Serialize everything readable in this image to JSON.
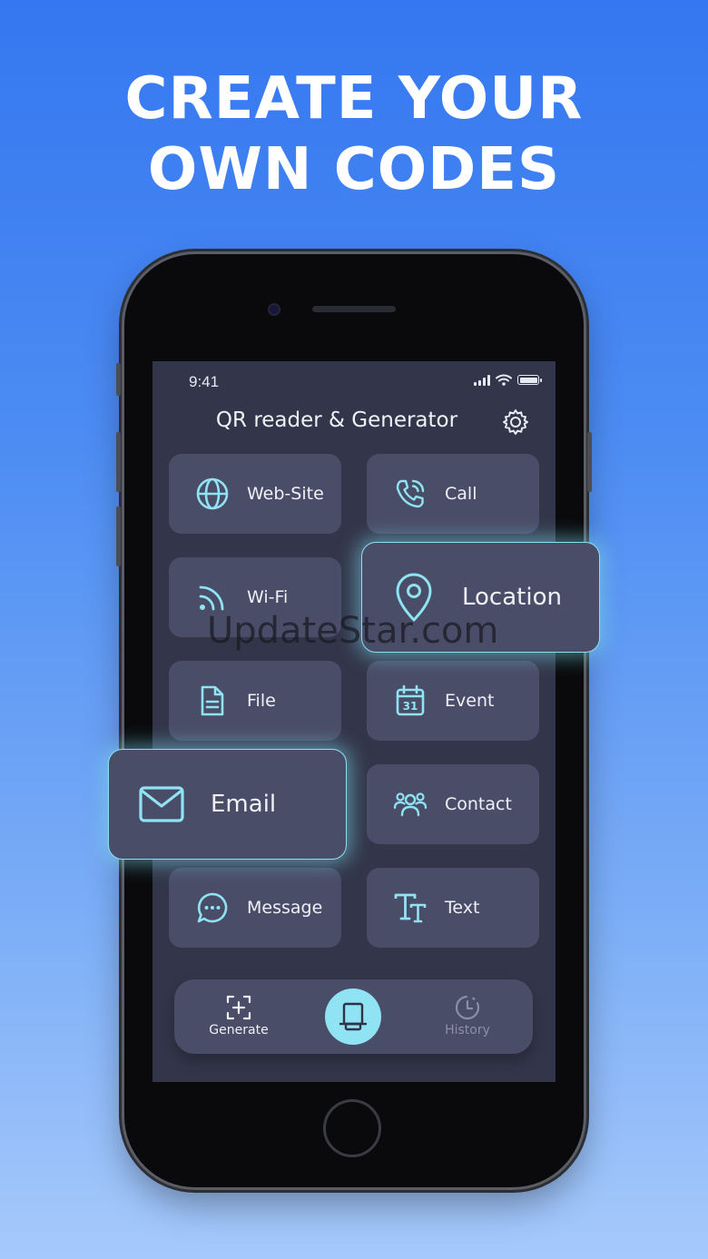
{
  "headline": {
    "line1": "CREATE YOUR",
    "line2": "OWN CODES"
  },
  "status_bar": {
    "time": "9:41"
  },
  "app": {
    "title": "QR reader & Generator"
  },
  "tiles": [
    {
      "label": "Web-Site",
      "icon": "globe-icon"
    },
    {
      "label": "Call",
      "icon": "phone-call-icon"
    },
    {
      "label": "Wi-Fi",
      "icon": "wifi-icon"
    },
    {
      "label": "Location",
      "icon": "location-pin-icon"
    },
    {
      "label": "File",
      "icon": "file-icon"
    },
    {
      "label": "Event",
      "icon": "calendar-icon"
    },
    {
      "label": "Email",
      "icon": "mail-icon"
    },
    {
      "label": "Contact",
      "icon": "contacts-icon"
    },
    {
      "label": "Message",
      "icon": "message-icon"
    },
    {
      "label": "Text",
      "icon": "text-icon"
    }
  ],
  "calendar_day": "31",
  "bottom_nav": {
    "generate": "Generate",
    "history": "History"
  },
  "watermark": "UpdateStar.com",
  "colors": {
    "accent": "#8fe3f2",
    "screen_bg": "#33364a",
    "tile_bg": "#4a4d67",
    "background_top": "#3577f0",
    "background_bottom": "#a6c9fb"
  }
}
